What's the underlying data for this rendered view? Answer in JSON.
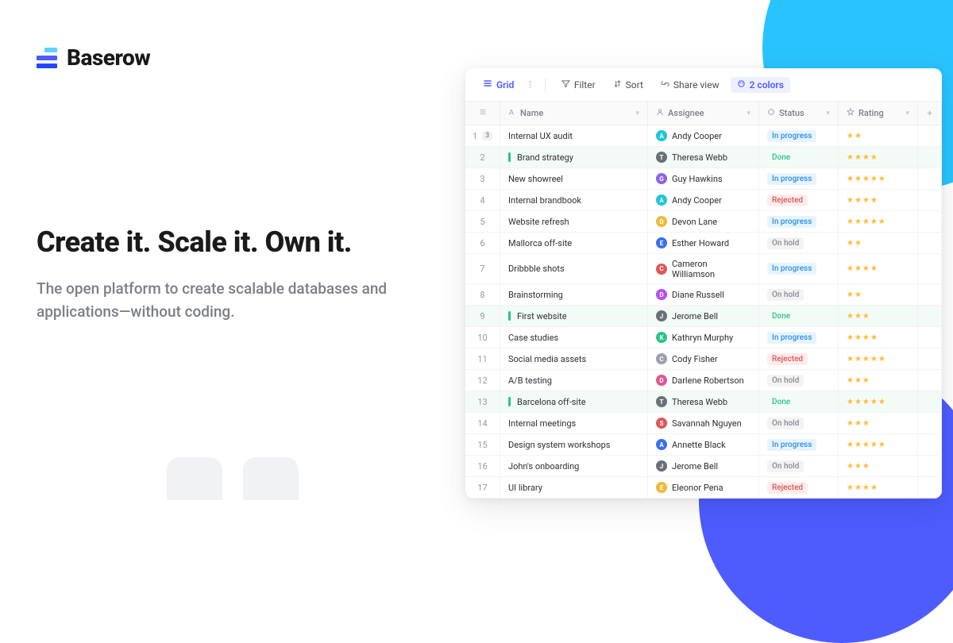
{
  "brand": "Baserow",
  "headline": "Create it. Scale it. Own it.",
  "subhead": "The open platform to create scalable databases and applications—without coding.",
  "toolbar": {
    "view": "Grid",
    "filter": "Filter",
    "sort": "Sort",
    "share": "Share view",
    "colors": "2 colors"
  },
  "columns": {
    "name": "Name",
    "assignee": "Assignee",
    "status": "Status",
    "rating": "Rating"
  },
  "statuses": {
    "in_progress": {
      "label": "In progress",
      "bg": "#e7f4ff",
      "fg": "#2e90e5"
    },
    "done": {
      "label": "Done",
      "bg": "transparent",
      "fg": "#2bc48a"
    },
    "rejected": {
      "label": "Rejected",
      "bg": "#ffecec",
      "fg": "#e05656"
    },
    "on_hold": {
      "label": "On hold",
      "bg": "#f3f3f4",
      "fg": "#888b92"
    }
  },
  "rows": [
    {
      "n": 1,
      "badge": "3",
      "name": "Internal UX audit",
      "assignee": "Andy Cooper",
      "av": "#1fc6d6",
      "status": "in_progress",
      "rating": 2
    },
    {
      "n": 2,
      "done": true,
      "name": "Brand strategy",
      "assignee": "Theresa Webb",
      "av": "#6b6f78",
      "status": "done",
      "rating": 4
    },
    {
      "n": 3,
      "name": "New showreel",
      "assignee": "Guy Hawkins",
      "av": "#8a63f0",
      "status": "in_progress",
      "rating": 5
    },
    {
      "n": 4,
      "name": "Internal brandbook",
      "assignee": "Andy Cooper",
      "av": "#1fc6d6",
      "status": "rejected",
      "rating": 4
    },
    {
      "n": 5,
      "name": "Website refresh",
      "assignee": "Devon Lane",
      "av": "#f0b93a",
      "status": "in_progress",
      "rating": 5
    },
    {
      "n": 6,
      "name": "Mallorca off-site",
      "assignee": "Esther Howard",
      "av": "#3a6ff0",
      "status": "on_hold",
      "rating": 2
    },
    {
      "n": 7,
      "name": "Dribbble shots",
      "assignee": "Cameron Williamson",
      "av": "#e05656",
      "status": "in_progress",
      "rating": 4
    },
    {
      "n": 8,
      "name": "Brainstorming",
      "assignee": "Diane Russell",
      "av": "#b84ff0",
      "status": "on_hold",
      "rating": 2
    },
    {
      "n": 9,
      "done": true,
      "name": "First website",
      "assignee": "Jerome Bell",
      "av": "#6b6f78",
      "status": "done",
      "rating": 3
    },
    {
      "n": 10,
      "name": "Case studies",
      "assignee": "Kathryn Murphy",
      "av": "#2bc48a",
      "status": "in_progress",
      "rating": 4
    },
    {
      "n": 11,
      "name": "Social media assets",
      "assignee": "Cody Fisher",
      "av": "#9aa0aa",
      "status": "rejected",
      "rating": 5
    },
    {
      "n": 12,
      "name": "A/B testing",
      "assignee": "Darlene Robertson",
      "av": "#e05690",
      "status": "on_hold",
      "rating": 3
    },
    {
      "n": 13,
      "done": true,
      "name": "Barcelona off-site",
      "assignee": "Theresa Webb",
      "av": "#6b6f78",
      "status": "done",
      "rating": 5
    },
    {
      "n": 14,
      "name": "Internal meetings",
      "assignee": "Savannah Nguyen",
      "av": "#e05656",
      "status": "on_hold",
      "rating": 3
    },
    {
      "n": 15,
      "name": "Design system workshops",
      "assignee": "Annette Black",
      "av": "#3a6ff0",
      "status": "in_progress",
      "rating": 5
    },
    {
      "n": 16,
      "name": "John's onboarding",
      "assignee": "Jerome Bell",
      "av": "#6b6f78",
      "status": "on_hold",
      "rating": 3
    },
    {
      "n": 17,
      "name": "UI library",
      "assignee": "Eleonor Pena",
      "av": "#f0b93a",
      "status": "rejected",
      "rating": 4
    }
  ]
}
